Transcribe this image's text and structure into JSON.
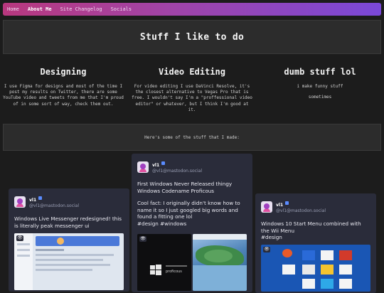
{
  "nav": {
    "links": [
      {
        "label": "Home",
        "active": false
      },
      {
        "label": "About Me",
        "active": true
      },
      {
        "label": "Site Changelog",
        "active": false
      },
      {
        "label": "Socials",
        "active": false
      }
    ]
  },
  "hero": {
    "title": "Stuff I like to do"
  },
  "columns": [
    {
      "title": "Designing",
      "text": "I use Figma for designs and most of the time I post my results on Twitter, there are some YouTube video and tweets from me that I'm proud of in some sort of way, check them out."
    },
    {
      "title": "Video Editing",
      "text": "For video editing I use DaVinci Resolve, it's the closest alternative to Vegas Pro that is free. I wouldn't say I'm a \"proffessional video editor\" or whatever, but I think I'm good at it."
    },
    {
      "title": "dumb stuff lol",
      "text": "i make funny stuff",
      "text2": "sometimes"
    }
  ],
  "band": {
    "text": "Here's some of the stuff that I made:"
  },
  "posts": [
    {
      "name": "vl1",
      "handle": "@vl1@mastodon.social",
      "text": "Windows Live Messenger redesigned! this is literally peak messenger ui",
      "tags": ""
    },
    {
      "name": "vl1",
      "handle": "@vl1@mastodon.social",
      "text": "First Windows Never Released thingy Windows Codename Proficous",
      "text_b": "Cool fact: I originally didn't know how to name it so I just googled big words and found a fitting one lol",
      "tags": "#design #windows",
      "media_caption": "proficous"
    },
    {
      "name": "vl1",
      "handle": "@vl1@mastodon.social",
      "text": "Windows 10 Start Menu combined with the Wii Menu",
      "tags": "#design"
    }
  ],
  "colors": {
    "nav_start": "#b8387e",
    "nav_end": "#7a48d8",
    "card_bg": "#2a2c3a",
    "page_bg": "#1c1c1c"
  }
}
